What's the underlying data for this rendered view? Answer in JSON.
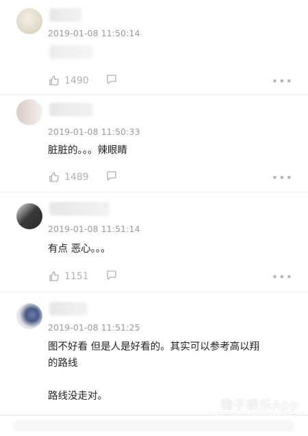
{
  "comments": [
    {
      "time": "2019-01-08 11:50:14",
      "text": "",
      "likes": "1490"
    },
    {
      "time": "2019-01-08 11:50:33",
      "text": "脏脏的。。。辣眼睛",
      "likes": "1489"
    },
    {
      "time": "2019-01-08 11:51:14",
      "text": "有点 恶心。。。",
      "likes": "1151"
    },
    {
      "time": "2019-01-08 11:51:25",
      "text": "图不好看 但是人是好看的。其实可以参考高以翔\n的路线\n\n路线没走对。",
      "likes": ""
    }
  ],
  "icons": {
    "like": "thumbs-up-icon",
    "reply": "comment-icon",
    "more": "more-icon"
  },
  "watermark": {
    "main": "嗨子娱乐App",
    "sub": "WWW.HAPPYJUZI.COM"
  },
  "colors": {
    "meta": "#999999",
    "icon": "#b0b0b0",
    "text": "#222222"
  }
}
